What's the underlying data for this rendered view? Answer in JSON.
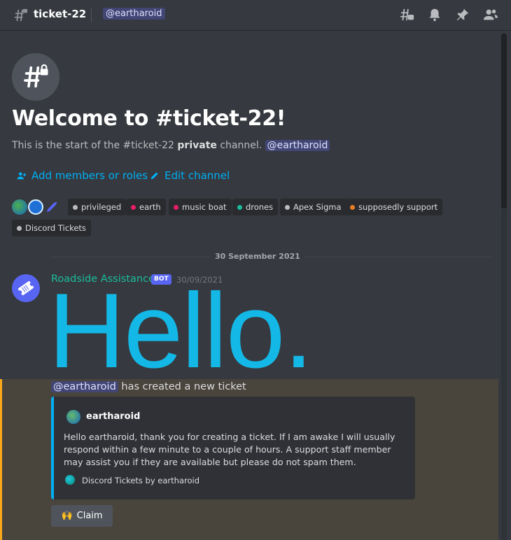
{
  "header": {
    "channel_name": "ticket-22",
    "topic_mention": "@eartharoid",
    "icons": [
      "threads-icon",
      "bell-icon",
      "pin-icon",
      "members-icon"
    ]
  },
  "welcome": {
    "title": "Welcome to #ticket-22!",
    "sub_prefix": "This is the start of the #ticket-22",
    "sub_bold": "private",
    "sub_suffix": "channel.",
    "sub_mention": "@eartharoid",
    "add_members_label": "Add members or roles",
    "edit_channel_label": "Edit channel"
  },
  "roles": [
    {
      "name": "privileged",
      "color": "#b9bbbe"
    },
    {
      "name": "earth",
      "color": "#e91e63"
    },
    {
      "name": "music boat",
      "color": "#e91e63"
    },
    {
      "name": "drones",
      "color": "#1abc9c"
    },
    {
      "name": "Apex Sigma",
      "color": "#b9bbbe"
    },
    {
      "name": "supposedly support",
      "color": "#e67e22"
    },
    {
      "name": "Discord Tickets",
      "color": "#b9bbbe"
    }
  ],
  "date_separator": "30 September 2021",
  "message": {
    "author": "Roadside Assistance",
    "bot_tag": "BOT",
    "timestamp": "30/09/2021",
    "image_text": "Hello.",
    "created_mention": "@eartharoid",
    "created_text": "has created a new ticket",
    "embed": {
      "author": "eartharoid",
      "description": "Hello eartharoid, thank you for creating a ticket. If I am awake I will usually respond within a few minute to a couple of hours. A support staff member may assist you if they are available but please do not spam them.",
      "footer": "Discord Tickets by eartharoid"
    },
    "claim_emoji": "🙌",
    "claim_label": "Claim"
  },
  "colors": {
    "background": "#36393f",
    "link": "#00aff4",
    "bot_name": "#1abc9c",
    "blurple": "#5865f2",
    "highlight": "#49443c",
    "highlight_border": "#faa81a",
    "hello": "#14b8e6"
  }
}
